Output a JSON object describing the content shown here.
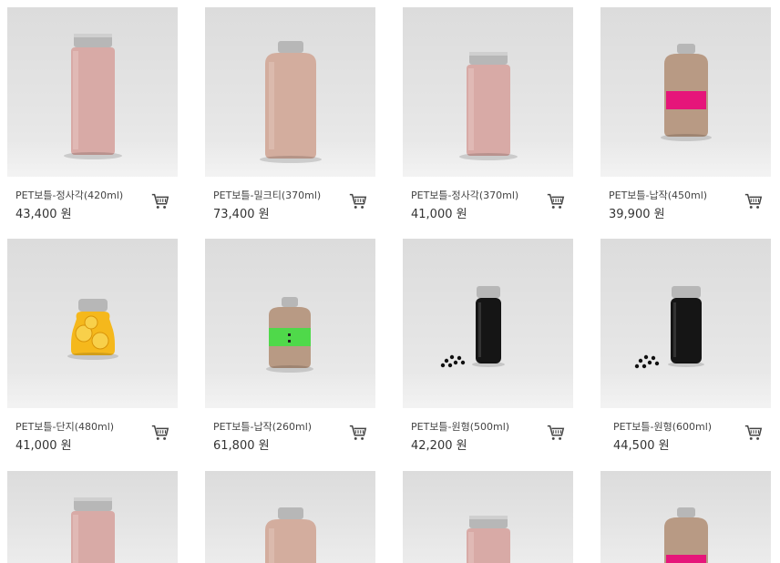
{
  "products": [
    {
      "name": "PET보틀-정사각(420ml)",
      "price": "43,400 원",
      "shape": "square-tall",
      "fill": "#d8aaa6",
      "cap": "silver",
      "cart_icon": "cart-icon"
    },
    {
      "name": "PET보틀-밀크티(370ml)",
      "price": "73,400 원",
      "shape": "round-flat",
      "fill": "#d3ad9e",
      "cap": "silver",
      "cart_icon": "cart-icon"
    },
    {
      "name": "PET보틀-정사각(370ml)",
      "price": "41,000 원",
      "shape": "square-mid",
      "fill": "#d8aaa6",
      "cap": "silver",
      "cart_icon": "cart-icon"
    },
    {
      "name": "PET보틀-납작(450ml)",
      "price": "39,900 원",
      "shape": "flask",
      "fill": "#b89a84",
      "cap": "silver",
      "label": "#e6157a",
      "cart_icon": "cart-icon"
    },
    {
      "name": "PET보틀-단지(480ml)",
      "price": "41,000 원",
      "shape": "jar",
      "fill": "#f5b81c",
      "cap": "silver",
      "cart_icon": "cart-icon"
    },
    {
      "name": "PET보틀-납작(260ml)",
      "price": "61,800 원",
      "shape": "flask-small",
      "fill": "#b89a84",
      "cap": "silver",
      "label": "#4fd94a",
      "cart_icon": "cart-icon"
    },
    {
      "name": "PET보틀-원형(500ml)",
      "price": "42,200 원",
      "shape": "cylinder-black",
      "fill": "#151515",
      "cap": "silver",
      "cart_icon": "cart-icon"
    },
    {
      "name": "PET보틀-원형(600ml)",
      "price": "44,500 원",
      "shape": "cylinder-black-wide",
      "fill": "#151515",
      "cap": "silver",
      "cart_icon": "cart-icon"
    },
    {
      "name": "",
      "price": "",
      "shape": "square-tall",
      "fill": "#d8aaa6",
      "cap": "silver"
    },
    {
      "name": "",
      "price": "",
      "shape": "round-flat",
      "fill": "#d3ad9e",
      "cap": "silver"
    },
    {
      "name": "",
      "price": "",
      "shape": "square-mid",
      "fill": "#d8aaa6",
      "cap": "silver"
    },
    {
      "name": "",
      "price": "",
      "shape": "flask",
      "fill": "#b89a84",
      "cap": "silver",
      "label": "#e6157a"
    }
  ]
}
